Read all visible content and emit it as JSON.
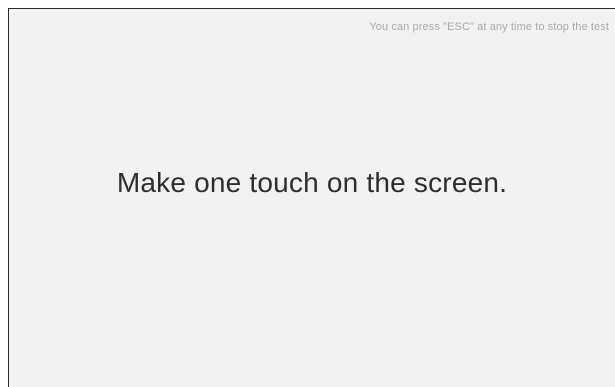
{
  "test_screen": {
    "esc_hint": "You can press \"ESC\" at any time to stop the test",
    "instruction": "Make one touch on the screen."
  }
}
